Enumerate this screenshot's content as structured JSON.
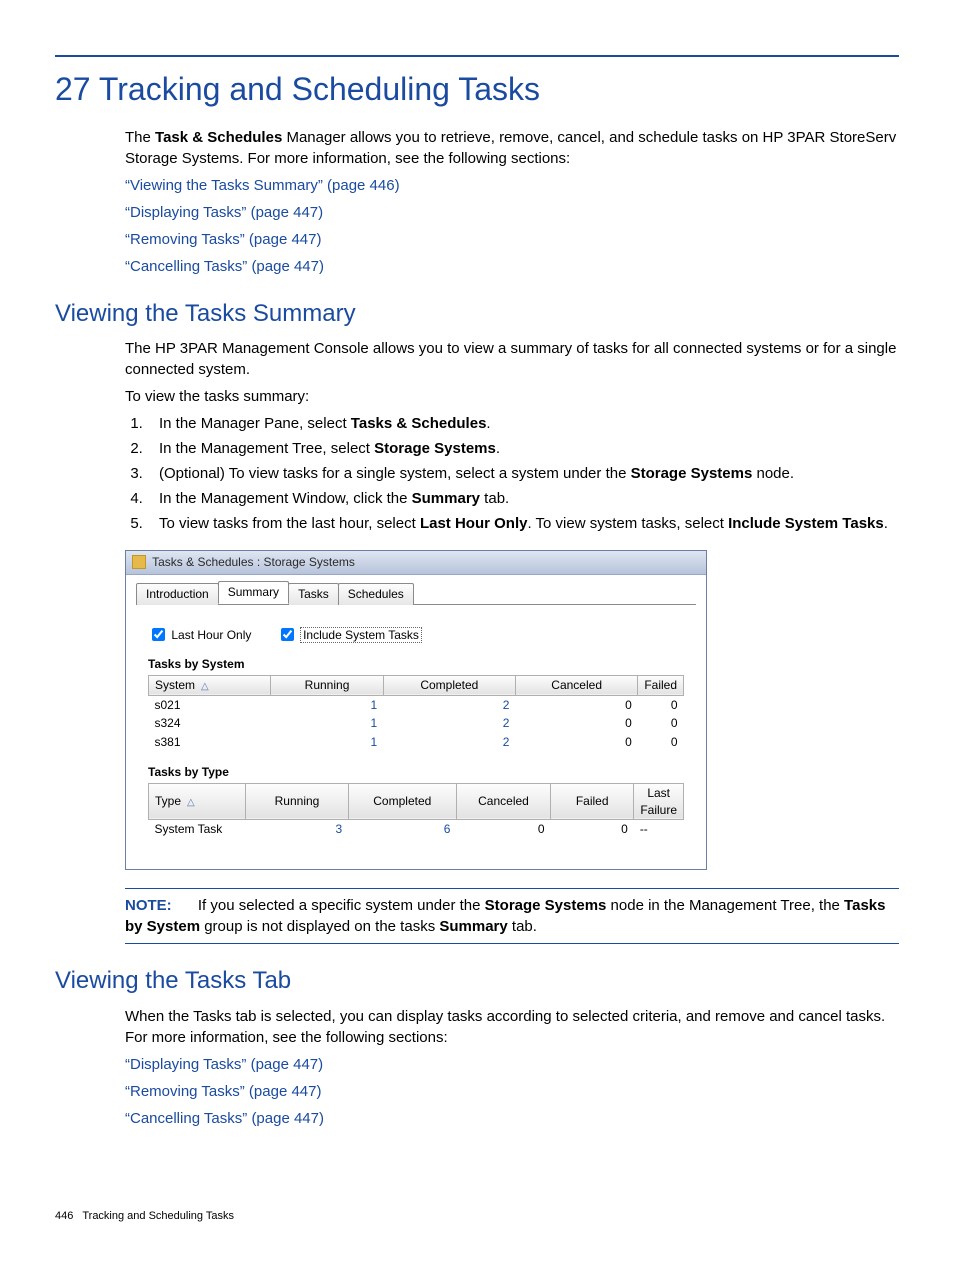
{
  "heading": "27 Tracking and Scheduling Tasks",
  "intro_a": "The ",
  "intro_b": "Task & Schedules",
  "intro_c": " Manager allows you to retrieve, remove, cancel, and schedule tasks on HP 3PAR StoreServ Storage Systems. For more information, see the following sections:",
  "links1": [
    "“Viewing the Tasks Summary” (page 446)",
    "“Displaying Tasks” (page 447)",
    "“Removing Tasks” (page 447)",
    "“Cancelling Tasks” (page 447)"
  ],
  "sec1_title": "Viewing the Tasks Summary",
  "sec1_p1": "The HP 3PAR Management Console allows you to view a summary of tasks for all connected systems or for a single connected system.",
  "sec1_p2": "To view the tasks summary:",
  "steps": {
    "s1a": "In the Manager Pane, select ",
    "s1b": "Tasks & Schedules",
    "s1c": ".",
    "s2a": "In the Management Tree, select ",
    "s2b": "Storage Systems",
    "s2c": ".",
    "s3a": "(Optional) To view tasks for a single system, select a system under the ",
    "s3b": "Storage Systems",
    "s3c": " node.",
    "s4a": "In the Management Window, click the ",
    "s4b": "Summary",
    "s4c": " tab.",
    "s5a": "To view tasks from the last hour, select ",
    "s5b": "Last Hour Only",
    "s5c": ". To view system tasks, select ",
    "s5d": "Include System Tasks",
    "s5e": "."
  },
  "panel": {
    "title": "Tasks & Schedules : Storage Systems",
    "tabs": [
      "Introduction",
      "Summary",
      "Tasks",
      "Schedules"
    ],
    "chk1": "Last Hour Only",
    "chk2": "Include System Tasks",
    "group1": "Tasks by System",
    "t1_headers": [
      "System",
      "Running",
      "Completed",
      "Canceled",
      "Failed"
    ],
    "t1_rows": [
      {
        "c0": "s021",
        "c1": "1",
        "c2": "2",
        "c3": "0",
        "c4": "0"
      },
      {
        "c0": "s324",
        "c1": "1",
        "c2": "2",
        "c3": "0",
        "c4": "0"
      },
      {
        "c0": "s381",
        "c1": "1",
        "c2": "2",
        "c3": "0",
        "c4": "0"
      }
    ],
    "group2": "Tasks by Type",
    "t2_headers": [
      "Type",
      "Running",
      "Completed",
      "Canceled",
      "Failed",
      "Last Failure"
    ],
    "t2_rows": [
      {
        "c0": "System Task",
        "c1": "3",
        "c2": "6",
        "c3": "0",
        "c4": "0",
        "c5": "--"
      }
    ]
  },
  "note_label": "NOTE:",
  "note_a": "If you selected a specific system under the ",
  "note_b": "Storage Systems",
  "note_c": " node in the Management Tree, the ",
  "note_d": "Tasks by System",
  "note_e": " group is not displayed on the tasks ",
  "note_f": "Summary",
  "note_g": " tab.",
  "sec2_title": "Viewing the Tasks Tab",
  "sec2_p1": "When the Tasks tab is selected, you can display tasks according to selected criteria, and remove and cancel tasks. For more information, see the following sections:",
  "links2": [
    "“Displaying Tasks” (page 447)",
    "“Removing Tasks” (page 447)",
    "“Cancelling Tasks” (page 447)"
  ],
  "footer_page": "446",
  "footer_title": "Tracking and Scheduling Tasks"
}
